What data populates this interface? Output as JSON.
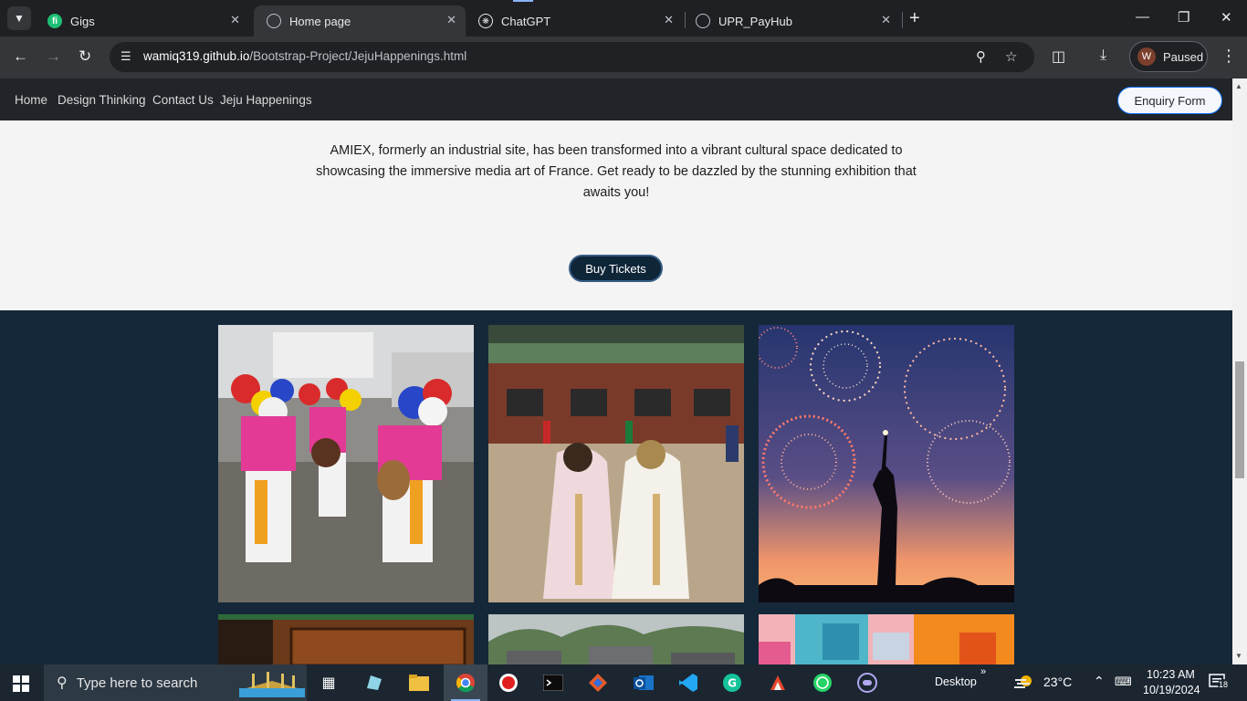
{
  "browser": {
    "tabs": [
      {
        "title": "Gigs",
        "active": false
      },
      {
        "title": "Home page",
        "active": true
      },
      {
        "title": "ChatGPT",
        "active": false
      },
      {
        "title": "UPR_PayHub",
        "active": false
      }
    ],
    "url_host": "wamiq319.github.io",
    "url_path": "/Bootstrap-Project/JejuHappenings.html",
    "profile_initial": "W",
    "profile_status": "Paused"
  },
  "site": {
    "nav": [
      "Home",
      "Design Thinking",
      "Contact Us",
      "Jeju Happenings"
    ],
    "enquiry_label": "Enquiry Form",
    "intro_text": "AMIEX, formerly an industrial site, has been transformed into a vibrant cultural space dedicated to showcasing the immersive media art of France. Get ready to be dazzled by the stunning exhibition that awaits you!",
    "buy_label": "Buy Tickets"
  },
  "taskbar": {
    "search_placeholder": "Type here to search",
    "desktop_label": "Desktop",
    "temperature": "23°C",
    "time": "10:23 AM",
    "date": "10/19/2024",
    "notifications": "18"
  },
  "colors": {
    "nav_bg": "#212529",
    "gallery_bg": "#15283a",
    "button_bg": "#0f2538",
    "accent": "#8ab4f8"
  }
}
